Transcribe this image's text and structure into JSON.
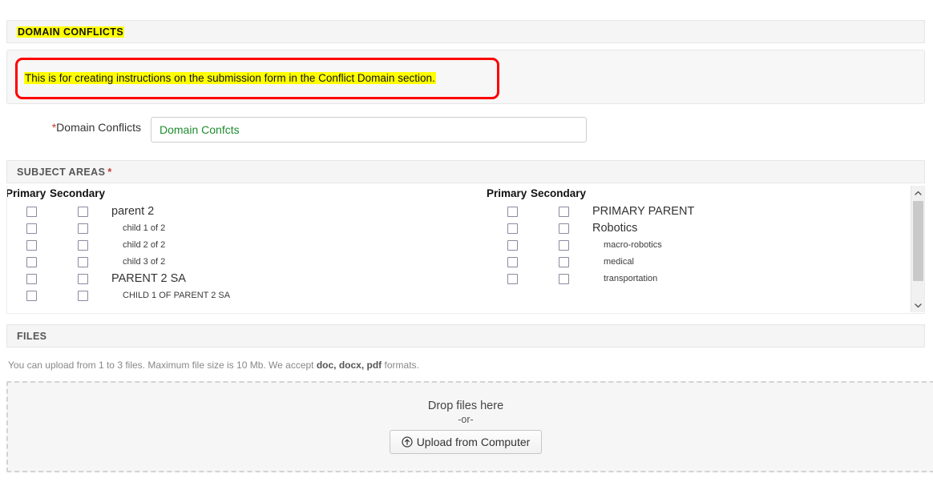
{
  "sections": {
    "domain_conflicts": {
      "title": "DOMAIN CONFLICTS"
    },
    "subject_areas": {
      "title": "SUBJECT AREAS",
      "required_mark": "*"
    },
    "files": {
      "title": "FILES"
    }
  },
  "instruction": {
    "text": "This is for creating instructions on the submission form in the Conflict Domain section.",
    "annotation_color": "#ff0000",
    "highlight_color": "#ffff00"
  },
  "domain_field": {
    "label": "Domain Conflicts",
    "required_mark": "*",
    "value": "Domain Confcts",
    "placeholder": "Domain Confcts",
    "text_color": "#1e8c2e"
  },
  "subject_areas": {
    "column_headers": {
      "primary": "Primary",
      "secondary": "Secondary"
    },
    "columns": [
      {
        "rows": [
          {
            "label": "parent 2",
            "level": "parent",
            "primary_checked": false,
            "secondary_checked": false
          },
          {
            "label": "child 1 of 2",
            "level": "child",
            "primary_checked": false,
            "secondary_checked": false
          },
          {
            "label": "child 2 of 2",
            "level": "child",
            "primary_checked": false,
            "secondary_checked": false
          },
          {
            "label": "child 3 of 2",
            "level": "child",
            "primary_checked": false,
            "secondary_checked": false
          },
          {
            "label": "PARENT 2 SA",
            "level": "parent",
            "primary_checked": false,
            "secondary_checked": false
          },
          {
            "label": "CHILD 1 OF PARENT 2 SA",
            "level": "child",
            "primary_checked": false,
            "secondary_checked": false
          }
        ]
      },
      {
        "rows": [
          {
            "label": "PRIMARY PARENT",
            "level": "parent",
            "primary_checked": false,
            "secondary_checked": false
          },
          {
            "label": "Robotics",
            "level": "parent",
            "primary_checked": false,
            "secondary_checked": false
          },
          {
            "label": "macro-robotics",
            "level": "child",
            "primary_checked": false,
            "secondary_checked": false
          },
          {
            "label": "medical",
            "level": "child",
            "primary_checked": false,
            "secondary_checked": false
          },
          {
            "label": "transportation",
            "level": "child",
            "primary_checked": false,
            "secondary_checked": false
          }
        ]
      }
    ],
    "scrollbar": {
      "up_icon": "chevron-up-icon",
      "down_icon": "chevron-down-icon"
    }
  },
  "files": {
    "note_prefix": "You can upload from 1 to 3 files. Maximum file size is 10 Mb. We accept ",
    "note_formats": "doc, docx, pdf",
    "note_suffix": " formats.",
    "dropzone": {
      "title": "Drop files here",
      "or": "-or-",
      "button_label": "Upload from Computer",
      "button_icon": "upload-circle-icon"
    }
  }
}
